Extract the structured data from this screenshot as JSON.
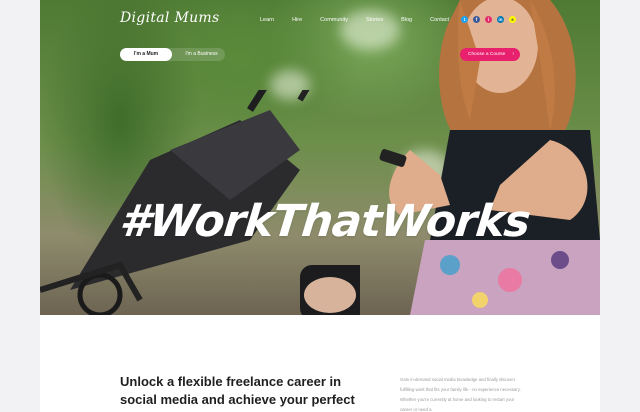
{
  "brand": {
    "logo_text": "Digital Mums"
  },
  "nav": {
    "links": [
      "Learn",
      "Hire",
      "Community",
      "Stories",
      "Blog",
      "Contact"
    ]
  },
  "social": [
    {
      "name": "twitter-icon",
      "glyph": "t",
      "color": "#1da1f2"
    },
    {
      "name": "facebook-icon",
      "glyph": "f",
      "color": "#3b5998"
    },
    {
      "name": "instagram-icon",
      "glyph": "i",
      "color": "#e1306c"
    },
    {
      "name": "linkedin-icon",
      "glyph": "in",
      "color": "#0077b5"
    },
    {
      "name": "snapchat-icon",
      "glyph": "s",
      "color": "#fffc00"
    }
  ],
  "toggle": {
    "option_mum": "I'm a Mum",
    "option_business": "I'm a Business"
  },
  "cta": {
    "label": "Choose a Course",
    "arrow": "›"
  },
  "hero": {
    "tagline": "#WorkThatWorks"
  },
  "content": {
    "headline": "Unlock a flexible freelance career in social media and achieve your perfect work/life",
    "body": "Gain in-demand social media knowledge and finally discover fulfilling work that fits your family life - no experience necessary. Whether you're currently at home and looking to restart your career or need a"
  },
  "colors": {
    "accent": "#e8206e",
    "headline": "#1f1f1f",
    "body_text": "#9a9a9a"
  }
}
